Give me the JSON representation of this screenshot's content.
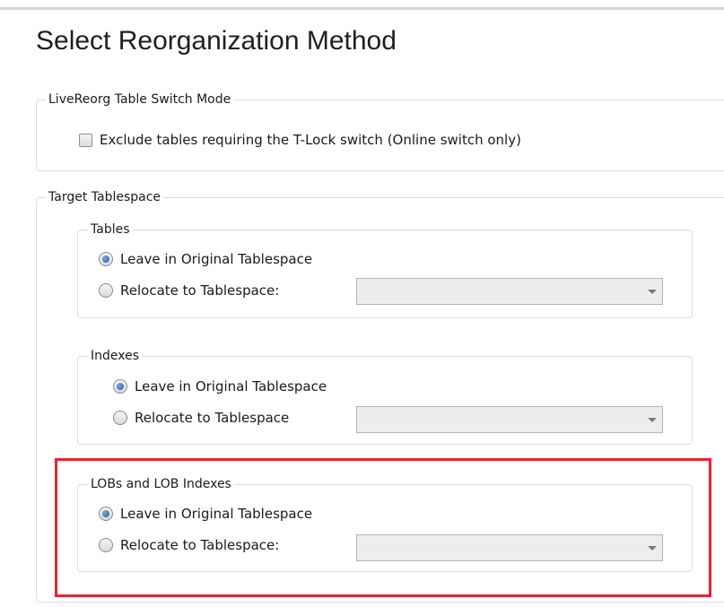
{
  "page_title": "Select Reorganization Method",
  "switch_mode": {
    "legend": "LiveReorg Table Switch Mode",
    "exclude_tlock": {
      "label": "Exclude tables requiring the T-Lock switch (Online switch only)",
      "checked": false
    }
  },
  "target_tablespace": {
    "legend": "Target Tablespace",
    "tables": {
      "legend": "Tables",
      "leave_label": "Leave in Original Tablespace",
      "relocate_label": "Relocate to Tablespace:",
      "selected": "leave",
      "relocate_value": ""
    },
    "indexes": {
      "legend": "Indexes",
      "leave_label": "Leave in Original Tablespace",
      "relocate_label": "Relocate to Tablespace",
      "selected": "leave",
      "relocate_value": ""
    },
    "lobs": {
      "legend": "LOBs and LOB Indexes",
      "leave_label": "Leave in Original Tablespace",
      "relocate_label": "Relocate to Tablespace:",
      "selected": "leave",
      "relocate_value": ""
    }
  },
  "colors": {
    "highlight": "#e8242c",
    "radio_dot": "#2c5aa0",
    "group_border": "#d8dde3"
  }
}
